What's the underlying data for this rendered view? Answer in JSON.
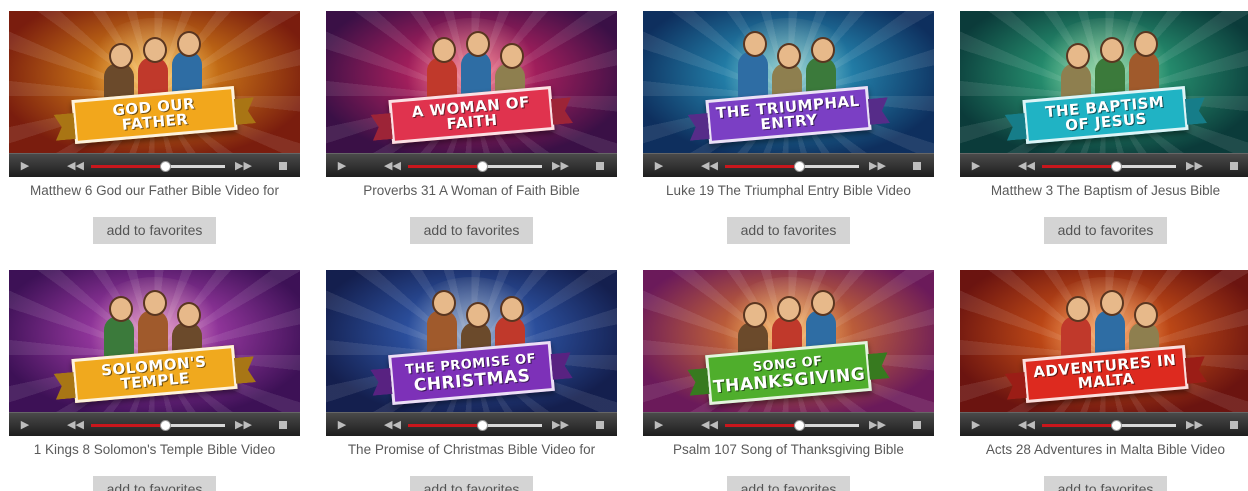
{
  "favorite_label": "add to favorites",
  "videos": [
    {
      "title": "Matthew 6 God our Father Bible Video for",
      "banner_l1": "GOD OUR FATHER",
      "banner_l2": "",
      "bg1": "#f3a11b",
      "bg2": "#7a1d0e",
      "banner_color": "#f2a71c",
      "progress": 0.55
    },
    {
      "title": "Proverbs 31 A Woman of Faith Bible",
      "banner_l1": "A WOMAN OF FAITH",
      "banner_l2": "",
      "bg1": "#e6286a",
      "bg2": "#3a1046",
      "banner_color": "#e0334e",
      "progress": 0.55
    },
    {
      "title": "Luke 19 The Triumphal Entry Bible Video",
      "banner_l1": "THE TRIUMPHAL ENTRY",
      "banner_l2": "",
      "bg1": "#2fb0d6",
      "bg2": "#0e2f5e",
      "banner_color": "#7b3fc4",
      "progress": 0.55
    },
    {
      "title": "Matthew 3 The Baptism of Jesus Bible",
      "banner_l1": "THE BAPTISM OF JESUS",
      "banner_l2": "",
      "bg1": "#36c08e",
      "bg2": "#0b3b3a",
      "banner_color": "#20b3c4",
      "progress": 0.55
    },
    {
      "title": "1 Kings 8 Solomon's Temple Bible Video",
      "banner_l1": "SOLOMON'S TEMPLE",
      "banner_l2": "",
      "bg1": "#c64cc6",
      "bg2": "#3d1156",
      "banner_color": "#f0a91e",
      "progress": 0.55
    },
    {
      "title": "The Promise of Christmas Bible Video for",
      "banner_l1": "THE PROMISE OF",
      "banner_l2": "CHRISTMAS",
      "bg1": "#3b6fd1",
      "bg2": "#141f4e",
      "banner_color": "#7d31b8",
      "progress": 0.55
    },
    {
      "title": "Psalm 107 Song of Thanksgiving Bible",
      "banner_l1": "SONG OF",
      "banner_l2": "THANKSGIVING",
      "bg1": "#f18a23",
      "bg2": "#6b1a5a",
      "banner_color": "#4fae2c",
      "progress": 0.55
    },
    {
      "title": "Acts 28 Adventures in Malta Bible Video",
      "banner_l1": "ADVENTURES IN MALTA",
      "banner_l2": "",
      "bg1": "#f26a1b",
      "bg2": "#6b1410",
      "banner_color": "#dd2a1f",
      "progress": 0.55
    }
  ],
  "icons": {
    "play": "play-icon",
    "rewind": "rewind-icon",
    "forward": "fast-forward-icon",
    "stop": "stop-icon"
  }
}
